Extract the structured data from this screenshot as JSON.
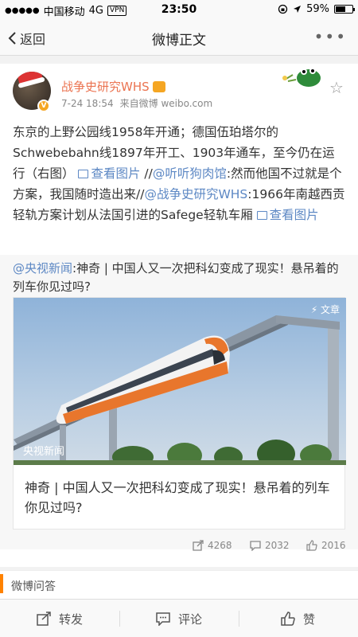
{
  "status_bar": {
    "carrier": "中国移动",
    "network": "4G",
    "vpn": "VPN",
    "time": "23:50",
    "battery": "59%",
    "battery_level": 0.59
  },
  "nav": {
    "back_label": "返回",
    "title": "微博正文",
    "more_icon": "more-icon"
  },
  "post": {
    "author": "战争史研究WHS",
    "time": "7-24 18:54",
    "source": "来自微博 weibo.com",
    "text": {
      "p1": "东京的上野公园线1958年开通；德国伍珀塔尔的Schwebebahn线1897年开工、1903年通车，至今仍在运行（右图）",
      "view_image_1": "查看图片",
      "sep1": "//",
      "mention1": "@听听狗肉馆",
      "p2": ":然而他国不过就是个方案，我国随时造出来//",
      "mention2": "@战争史研究WHS",
      "p3": ":1966年南越西贡轻轨方案计划从法国引进的Safege轻轨车厢",
      "view_image_2": "查看图片"
    }
  },
  "repost": {
    "mention": "@央视新闻",
    "text": ":神奇 | 中国人又一次把科幻变成了现实！悬吊着的列车你见过吗?",
    "article": {
      "tag": "文章",
      "source_watermark": "央视新闻",
      "title": "神奇 | 中国人又一次把科幻变成了现实！悬吊着的列车你见过吗?"
    }
  },
  "stats": {
    "reposts": "4268",
    "comments": "2032",
    "likes": "2016"
  },
  "qa": {
    "label": "微博问答"
  },
  "toolbar": {
    "repost_label": "转发",
    "comment_label": "评论",
    "like_label": "赞"
  },
  "colors": {
    "accent": "#eb7350",
    "link": "#5d88c4",
    "orange_bar": "#ff8200"
  }
}
